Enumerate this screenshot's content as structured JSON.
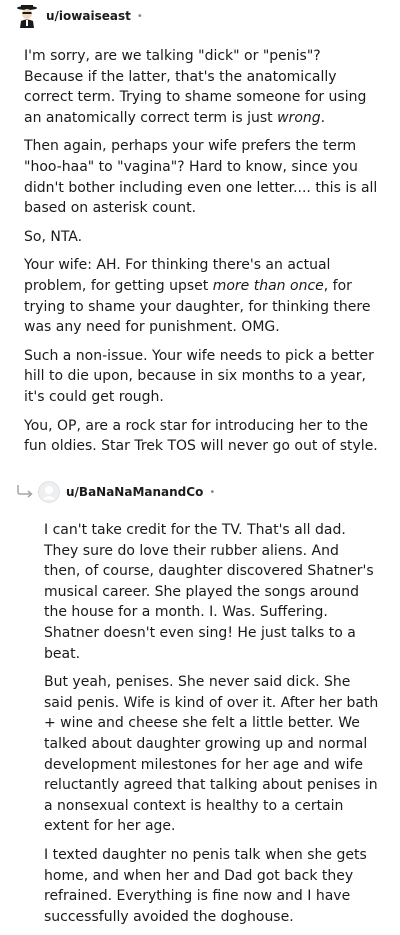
{
  "comment1": {
    "author": "u/iowaiseast",
    "separator": "•",
    "paragraphs": [
      {
        "a": "I'm sorry, are we talking \"dick\" or \"penis\"? Because if the latter, that's the anatomically correct term. Trying to shame someone for using an anatomically correct term is just ",
        "em": "wrong",
        "b": "."
      },
      {
        "a": "Then again, perhaps your wife prefers the term \"hoo-haa\" to \"vagina\"? Hard to know, since you didn't bother including even one letter.... this is all based on asterisk count.",
        "em": "",
        "b": ""
      },
      {
        "a": "So, NTA.",
        "em": "",
        "b": ""
      },
      {
        "a": "Your wife: AH. For thinking there's an actual problem, for getting upset ",
        "em": "more than once",
        "b": ", for trying to shame your daughter, for thinking there was any need for punishment. OMG."
      },
      {
        "a": "Such a non-issue. Your wife needs to pick a better hill to die upon, because in six months to a year, it's could get rough.",
        "em": "",
        "b": ""
      },
      {
        "a": "You, OP, are a rock star for introducing her to the fun oldies. Star Trek TOS will never go out of style.",
        "em": "",
        "b": ""
      }
    ]
  },
  "comment2": {
    "author": "u/BaNaNaManandCo",
    "separator": "•",
    "paragraphs": [
      "I can't take credit for the TV. That's all dad. They sure do love their rubber aliens. And then, of course, daughter discovered Shatner's musical career. She played the songs around the house for a month. I. Was. Suffering. Shatner doesn't even sing! He just talks to a beat.",
      "But yeah, penises. She never said dick. She said penis. Wife is kind of over it. After her bath + wine and cheese she felt a little better. We talked about daughter growing up and normal development milestones for her age and wife reluctantly agreed that talking about penises in a nonsexual context is healthy to a certain extent for her age.",
      "I texted daughter no penis talk when she gets home, and when her and Dad got back they refrained. Everything is fine now and I have successfully avoided the doghouse."
    ]
  }
}
